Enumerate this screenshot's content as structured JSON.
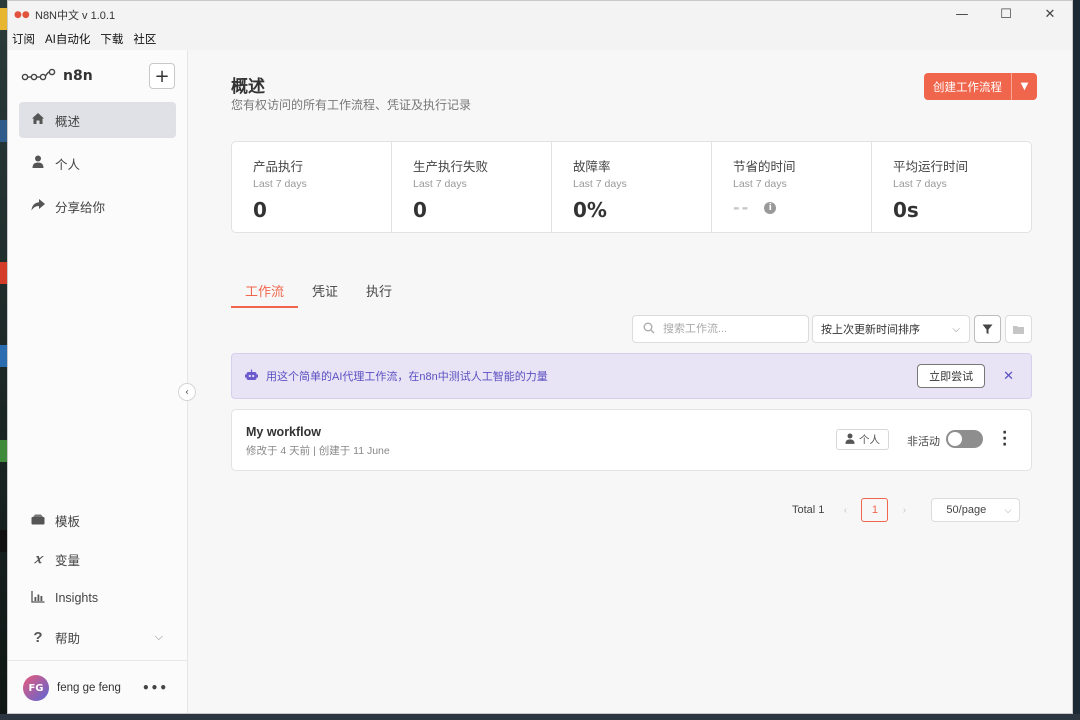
{
  "window": {
    "title": "N8N中文 v 1.0.1",
    "controls": {
      "minimize": "—",
      "maximize": "☐",
      "close": "✕"
    }
  },
  "menubar": [
    "订阅",
    "AI自动化",
    "下载",
    "社区"
  ],
  "sidebar": {
    "brand": "n8n",
    "add_label": "+",
    "nav_top": [
      {
        "label": "概述",
        "icon": "home-icon",
        "active": true
      },
      {
        "label": "个人",
        "icon": "user-icon",
        "active": false
      },
      {
        "label": "分享给你",
        "icon": "share-icon",
        "active": false
      }
    ],
    "nav_bottom": [
      {
        "label": "模板",
        "icon": "template-icon"
      },
      {
        "label": "变量",
        "icon": "variable-icon"
      },
      {
        "label": "Insights",
        "icon": "insights-icon"
      },
      {
        "label": "帮助",
        "icon": "help-icon"
      }
    ],
    "user": {
      "initials": "FG",
      "name": "feng ge feng"
    }
  },
  "header": {
    "title": "概述",
    "subtitle": "您有权访问的所有工作流程、凭证及执行记录",
    "create_button": "创建工作流程"
  },
  "stats": [
    {
      "name": "产品执行",
      "range": "Last 7 days",
      "value": "0"
    },
    {
      "name": "生产执行失败",
      "range": "Last 7 days",
      "value": "0"
    },
    {
      "name": "故障率",
      "range": "Last 7 days",
      "value": "0%"
    },
    {
      "name": "节省的时间",
      "range": "Last 7 days",
      "value": "--"
    },
    {
      "name": "平均运行时间",
      "range": "Last 7 days",
      "value": "0s"
    }
  ],
  "tabs": [
    {
      "label": "工作流",
      "active": true
    },
    {
      "label": "凭证",
      "active": false
    },
    {
      "label": "执行",
      "active": false
    }
  ],
  "toolbar": {
    "search_placeholder": "搜索工作流...",
    "sort_value": "按上次更新时间排序"
  },
  "banner": {
    "text": "用这个简单的AI代理工作流，在n8n中测试人工智能的力量",
    "button": "立即尝试"
  },
  "workflow": {
    "name": "My workflow",
    "meta": "修改于 4 天前 | 创建于 11 June",
    "owner": "个人",
    "status": "非活动",
    "active": false
  },
  "pagination": {
    "total": "Total 1",
    "current_page": "1",
    "page_size": "50/page"
  },
  "colors": {
    "accent": "#f0664d",
    "banner_bg": "#e8e4f6",
    "banner_text": "#5b4fc0",
    "active_nav_bg": "#dfe1e6"
  }
}
